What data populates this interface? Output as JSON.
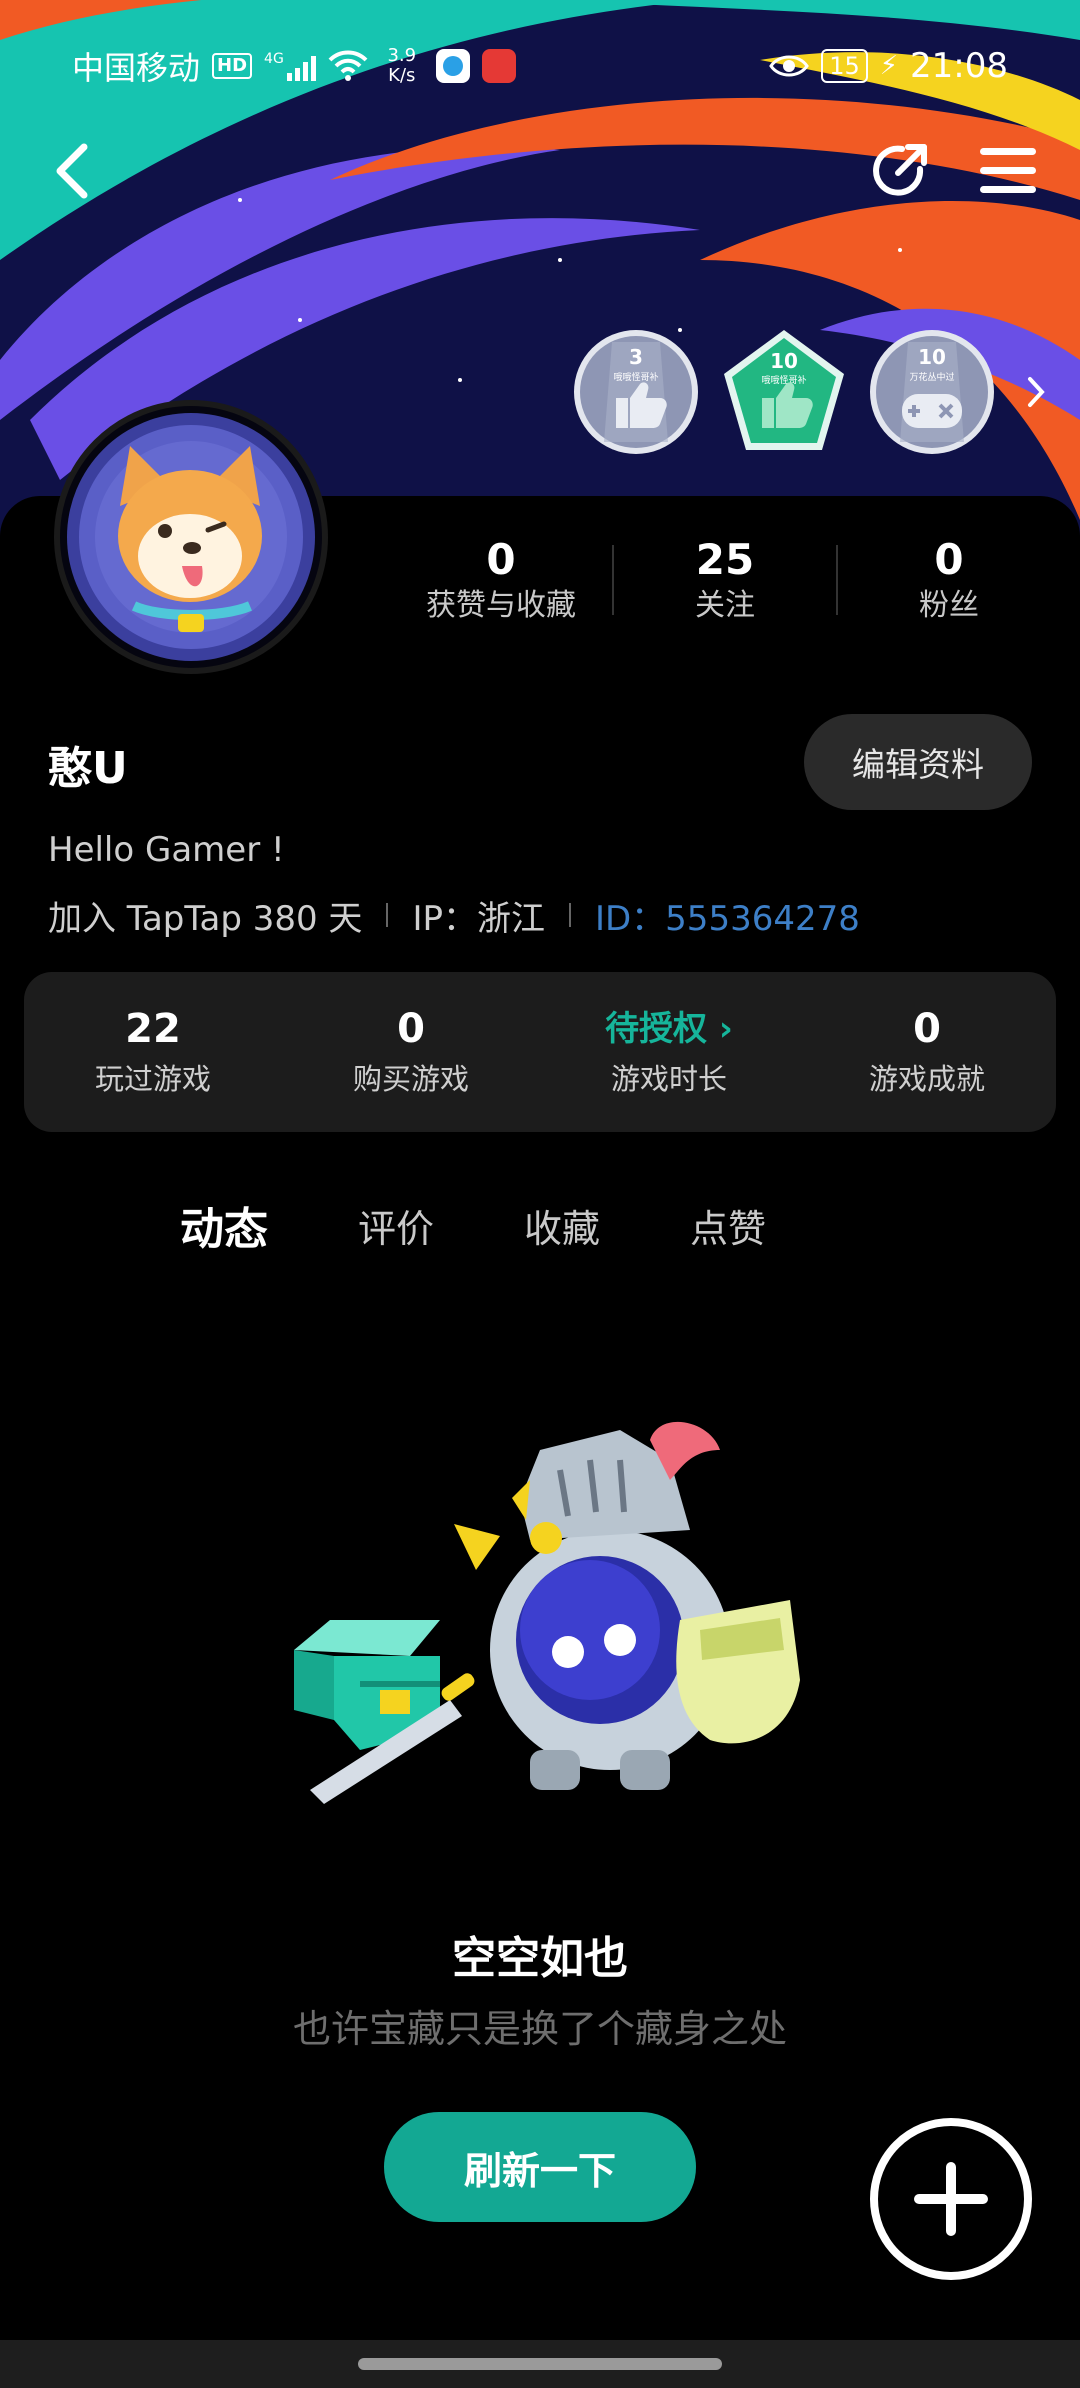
{
  "status_bar": {
    "carrier": "中国移动",
    "hd": "HD",
    "network": "4G",
    "speed_value": "3.9",
    "speed_unit": "K/s",
    "battery": "15",
    "time": "21:08"
  },
  "badges": [
    {
      "count": "3",
      "text": "哦哦怪哥补",
      "icon": "thumbs-up-icon"
    },
    {
      "count": "10",
      "text": "哦哦怪哥补",
      "icon": "thumbs-up-icon"
    },
    {
      "count": "10",
      "text": "万花丛中过",
      "icon": "gamepad-icon"
    }
  ],
  "profile": {
    "stats": [
      {
        "value": "0",
        "label": "获赞与收藏"
      },
      {
        "value": "25",
        "label": "关注"
      },
      {
        "value": "0",
        "label": "粉丝"
      }
    ],
    "username": "憨U",
    "edit_label": "编辑资料",
    "bio": "Hello Gamer !",
    "joined": "加入 TapTap 380 天",
    "ip": "IP：浙江",
    "id": "ID：555364278"
  },
  "game_stats": [
    {
      "value": "22",
      "label": "玩过游戏"
    },
    {
      "value": "0",
      "label": "购买游戏"
    },
    {
      "value": "待授权 ›",
      "label": "游戏时长"
    },
    {
      "value": "0",
      "label": "游戏成就"
    }
  ],
  "tabs": [
    "动态",
    "评价",
    "收藏",
    "点赞"
  ],
  "empty_state": {
    "title": "空空如也",
    "subtitle": "也许宝藏只是换了个藏身之处",
    "refresh_label": "刷新一下"
  },
  "colors": {
    "accent": "#16b59b",
    "link": "#3d7fc7",
    "background": "#000000"
  }
}
